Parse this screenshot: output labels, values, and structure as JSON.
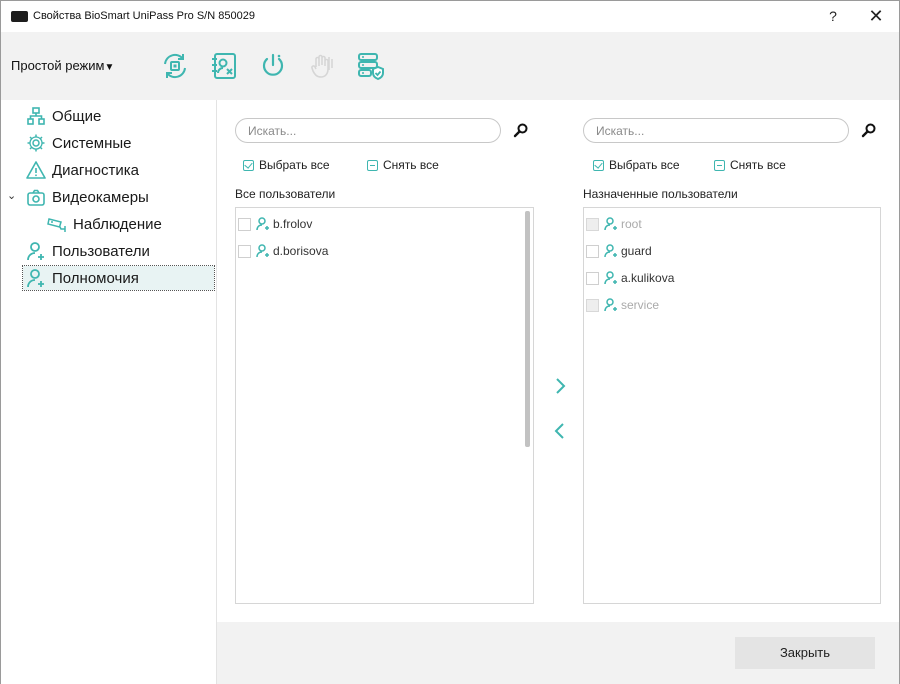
{
  "window": {
    "title": "Свойства BioSmart UniPass Pro S/N 850029",
    "help": "?",
    "close": "✕"
  },
  "toolbar": {
    "mode_label": "Простой режим",
    "mode_caret": "▼",
    "buttons": [
      "sync-icon",
      "user-remove-icon",
      "power-icon",
      "hand-icon-disabled",
      "server-check-icon"
    ]
  },
  "nav": {
    "expand_arrow": "⌄",
    "items": [
      {
        "label": "Общие",
        "icon": "network-icon"
      },
      {
        "label": "Системные",
        "icon": "gear-icon"
      },
      {
        "label": "Диагностика",
        "icon": "warning-icon"
      },
      {
        "label": "Видеокамеры",
        "icon": "camera-icon"
      },
      {
        "label": "Наблюдение",
        "icon": "cctv-icon"
      },
      {
        "label": "Пользователи",
        "icon": "user-add-icon"
      },
      {
        "label": "Полномочия",
        "icon": "user-add-icon"
      }
    ]
  },
  "left_panel": {
    "search_placeholder": "Искать...",
    "select_all": "Выбрать все",
    "deselect_all": "Снять все",
    "title": "Все пользователи",
    "users": [
      {
        "name": "b.frolov",
        "disabled": false
      },
      {
        "name": "d.borisova",
        "disabled": false
      }
    ]
  },
  "right_panel": {
    "search_placeholder": "Искать...",
    "select_all": "Выбрать все",
    "deselect_all": "Снять все",
    "title": "Назначенные пользователи",
    "users": [
      {
        "name": "root",
        "disabled": true
      },
      {
        "name": "guard",
        "disabled": false
      },
      {
        "name": "a.kulikova",
        "disabled": false
      },
      {
        "name": "service",
        "disabled": true
      }
    ]
  },
  "transfer": {
    "add": ">",
    "remove": "<"
  },
  "footer": {
    "close_label": "Закрыть"
  },
  "colors": {
    "accent": "#3fb6b0",
    "panel_bg": "#f2f2f2",
    "selected_bg": "#e8f3f3"
  }
}
